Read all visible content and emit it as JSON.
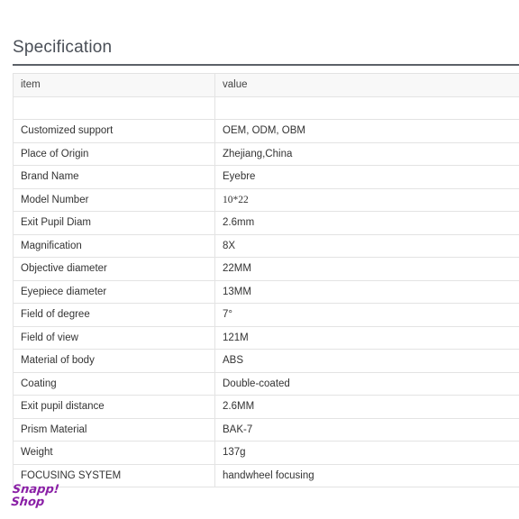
{
  "title": "Specification",
  "table": {
    "headers": [
      "item",
      "value"
    ],
    "rows": [
      {
        "item": "",
        "value": ""
      },
      {
        "item": "Customized support",
        "value": "OEM, ODM, OBM"
      },
      {
        "item": "Place of Origin",
        "value": "Zhejiang,China"
      },
      {
        "item": "Brand Name",
        "value": "Eyebre"
      },
      {
        "item": "Model Number",
        "value": "10*22"
      },
      {
        "item": "Exit Pupil Diam",
        "value": "2.6mm"
      },
      {
        "item": "Magnification",
        "value": "8X"
      },
      {
        "item": "Objective diameter",
        "value": "22MM"
      },
      {
        "item": "Eyepiece diameter",
        "value": "13MM"
      },
      {
        "item": "Field of degree",
        "value": "7°"
      },
      {
        "item": "Field of view",
        "value": "121M"
      },
      {
        "item": "Material of body",
        "value": "ABS"
      },
      {
        "item": "Coating",
        "value": "Double-coated"
      },
      {
        "item": "Exit pupil distance",
        "value": "2.6MM"
      },
      {
        "item": "Prism Material",
        "value": "BAK-7"
      },
      {
        "item": "Weight",
        "value": "137g"
      },
      {
        "item": "FOCUSING SYSTEM",
        "value": "handwheel focusing"
      }
    ]
  },
  "watermark": {
    "line1": "Snapp!",
    "line2": "Shop",
    "color": "#8a1fa6"
  },
  "colors": {
    "heading": "#4a4f57",
    "rule": "#5c6168",
    "border": "#e3e3e3",
    "header_bg": "#f8f8f8"
  }
}
